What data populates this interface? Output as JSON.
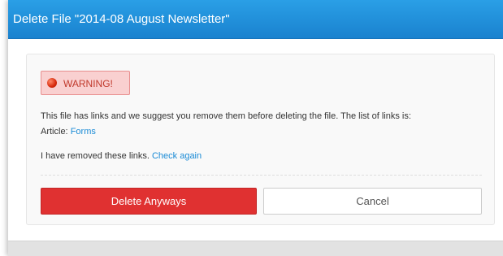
{
  "dialog": {
    "title": "Delete File \"2014-08 August Newsletter\""
  },
  "warning": {
    "icon": "warning-dot-icon",
    "label": "WARNING!"
  },
  "message": {
    "main": "This file has links and we suggest you remove them before deleting the file. The list of links is:",
    "article_prefix": "Article: ",
    "article_link": "Forms",
    "removed_text": "I have removed these links. ",
    "check_again": "Check again"
  },
  "buttons": {
    "delete": "Delete Anyways",
    "cancel": "Cancel"
  },
  "colors": {
    "header": "#1a8ad4",
    "danger": "#e03131",
    "link": "#1a8bd6"
  }
}
